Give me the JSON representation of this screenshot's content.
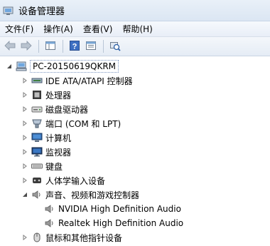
{
  "window": {
    "title": "设备管理器"
  },
  "menu": [
    {
      "label": "文件(F)"
    },
    {
      "label": "操作(A)"
    },
    {
      "label": "查看(V)"
    },
    {
      "label": "帮助(H)"
    }
  ],
  "tree": {
    "root": {
      "label": "PC-20150619QKRM"
    },
    "categories": [
      {
        "label": "IDE ATA/ATAPI 控制器",
        "icon": "ide-controller-icon"
      },
      {
        "label": "处理器",
        "icon": "processor-icon"
      },
      {
        "label": "磁盘驱动器",
        "icon": "disk-drive-icon"
      },
      {
        "label": "端口 (COM 和 LPT)",
        "icon": "port-icon"
      },
      {
        "label": "计算机",
        "icon": "computer-icon"
      },
      {
        "label": "监视器",
        "icon": "monitor-icon"
      },
      {
        "label": "键盘",
        "icon": "keyboard-icon"
      },
      {
        "label": "人体学输入设备",
        "icon": "hid-icon"
      },
      {
        "label": "声音、视频和游戏控制器",
        "icon": "sound-icon",
        "expanded": true
      },
      {
        "label": "鼠标和其他指针设备",
        "icon": "mouse-icon"
      }
    ],
    "sound_children": [
      {
        "label": "NVIDIA High Definition Audio"
      },
      {
        "label": "Realtek High Definition Audio"
      }
    ]
  },
  "colors": {
    "accent": "#3a6ea5",
    "titlebar": "#dbe6f3"
  }
}
